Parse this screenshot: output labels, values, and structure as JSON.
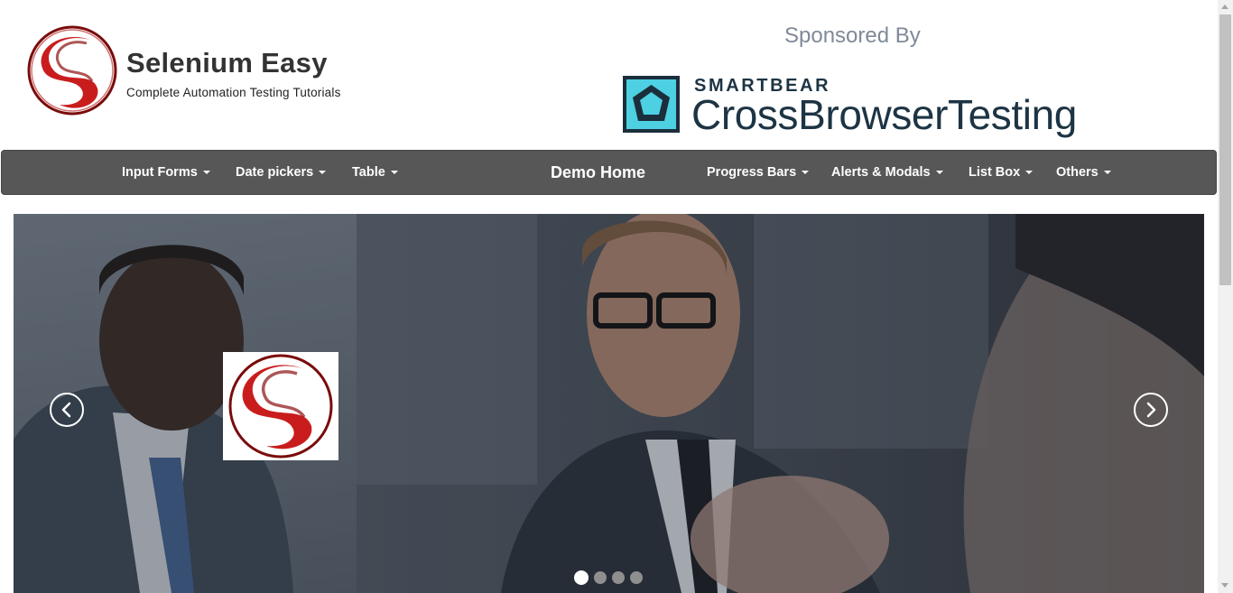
{
  "brand": {
    "title": "Selenium Easy",
    "tagline": "Complete Automation Testing Tutorials",
    "logo_icon": "selenium-easy-s-logo",
    "colors": {
      "red": "#c91d1d",
      "dark_red": "#7a0c0c"
    }
  },
  "sponsor": {
    "heading": "Sponsored By",
    "company": "SMARTBEAR",
    "product": "CrossBrowserTesting",
    "icon": "smartbear-icon",
    "colors": {
      "text": "#1d3444",
      "icon_bg": "#1b2e3c",
      "icon_accent": "#4dd0e1"
    }
  },
  "navbar": {
    "bg_color": "#575757",
    "items": [
      {
        "label": "Input Forms",
        "dropdown": true
      },
      {
        "label": "Date pickers",
        "dropdown": true
      },
      {
        "label": "Table",
        "dropdown": true
      },
      {
        "label": "Demo Home",
        "dropdown": false
      },
      {
        "label": "Progress Bars",
        "dropdown": true
      },
      {
        "label": "Alerts & Modals",
        "dropdown": true
      },
      {
        "label": "List Box",
        "dropdown": true
      },
      {
        "label": "Others",
        "dropdown": true
      }
    ]
  },
  "carousel": {
    "slide_logo_icon": "selenium-easy-s-logo",
    "prev_icon": "chevron-left-icon",
    "next_icon": "chevron-right-icon",
    "slide_count": 4,
    "active_slide": 1
  }
}
